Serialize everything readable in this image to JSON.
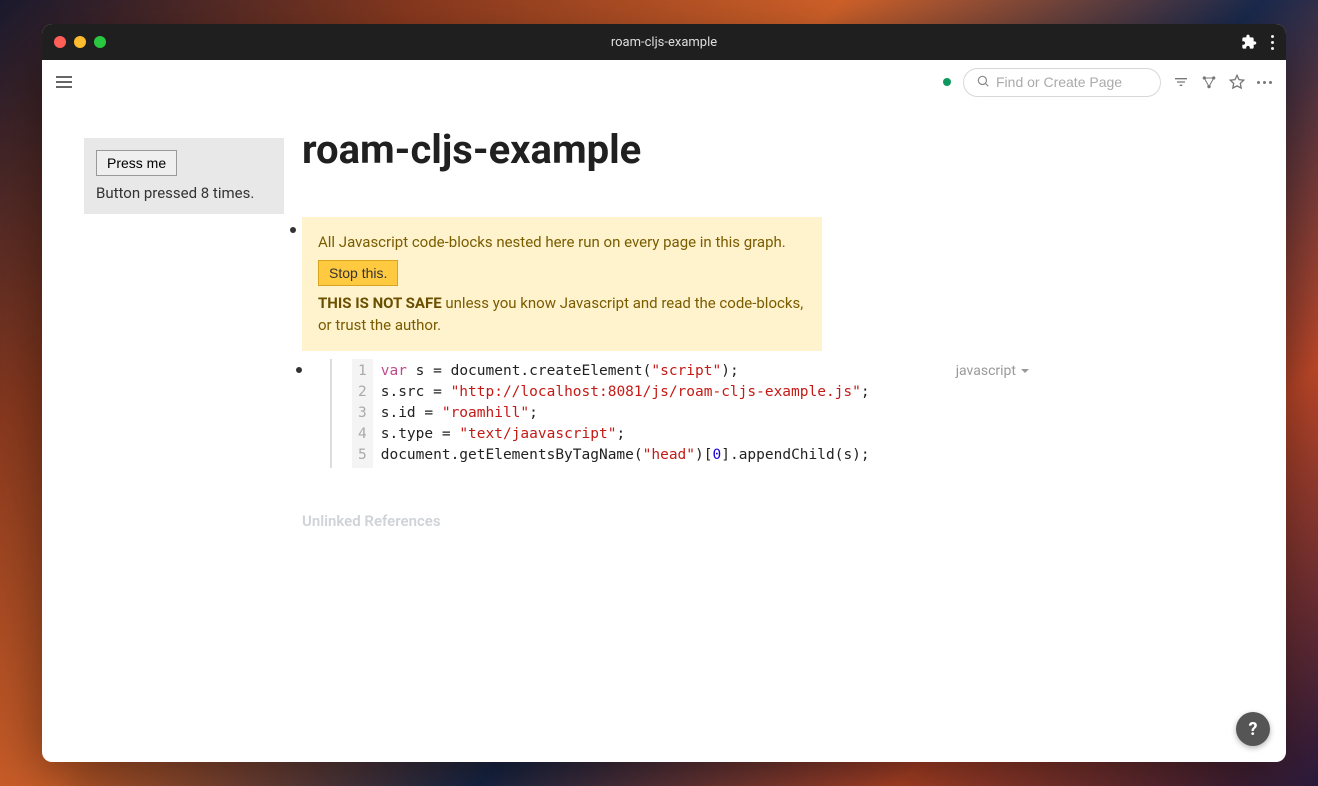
{
  "window": {
    "title": "roam-cljs-example"
  },
  "topbar": {
    "search_placeholder": "Find or Create Page"
  },
  "sidebar_widget": {
    "button_label": "Press me",
    "status_text": "Button pressed 8 times."
  },
  "page": {
    "title": "roam-cljs-example",
    "unlinked_label": "Unlinked References"
  },
  "warning": {
    "line1": "All Javascript code-blocks nested here run on every page in this graph.",
    "stop_label": "Stop this.",
    "bold": "THIS IS NOT SAFE",
    "rest": " unless you know Javascript and read the code-blocks, or trust the author."
  },
  "code": {
    "language": "javascript",
    "line_numbers": [
      "1",
      "2",
      "3",
      "4",
      "5"
    ],
    "lines": [
      {
        "tokens": [
          {
            "c": "kw",
            "t": "var"
          },
          {
            "c": "plain",
            "t": " s = document.createElement("
          },
          {
            "c": "str",
            "t": "\"script\""
          },
          {
            "c": "plain",
            "t": ");"
          }
        ]
      },
      {
        "tokens": [
          {
            "c": "plain",
            "t": "s.src = "
          },
          {
            "c": "str",
            "t": "\"http://localhost:8081/js/roam-cljs-example.js\""
          },
          {
            "c": "plain",
            "t": ";"
          }
        ]
      },
      {
        "tokens": [
          {
            "c": "plain",
            "t": "s.id = "
          },
          {
            "c": "str",
            "t": "\"roamhill\""
          },
          {
            "c": "plain",
            "t": ";"
          }
        ]
      },
      {
        "tokens": [
          {
            "c": "plain",
            "t": "s.type = "
          },
          {
            "c": "str",
            "t": "\"text/jaavascript\""
          },
          {
            "c": "plain",
            "t": ";"
          }
        ]
      },
      {
        "tokens": [
          {
            "c": "plain",
            "t": "document.getElementsByTagName("
          },
          {
            "c": "str",
            "t": "\"head\""
          },
          {
            "c": "plain",
            "t": ")["
          },
          {
            "c": "num",
            "t": "0"
          },
          {
            "c": "plain",
            "t": "].appendChild(s);"
          }
        ]
      }
    ]
  }
}
